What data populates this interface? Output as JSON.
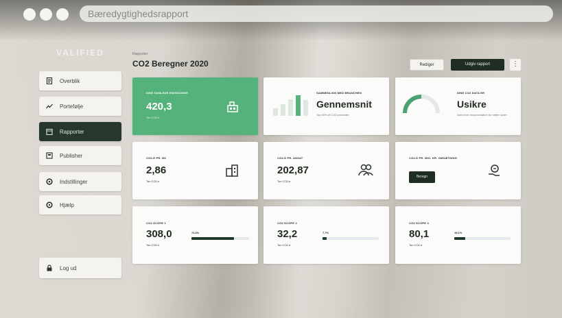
{
  "window": {
    "url_title": "Bæredygtighedsrapport"
  },
  "brand": {
    "logo_text": "VALIFIED"
  },
  "sidebar": {
    "items": [
      {
        "label": "Overblik",
        "icon": "document-icon"
      },
      {
        "label": "Portefølje",
        "icon": "trend-line-icon"
      },
      {
        "label": "Rapporter",
        "icon": "calendar-icon",
        "active": true
      },
      {
        "label": "Publisher",
        "icon": "publish-icon"
      },
      {
        "label": "Indstillinger",
        "icon": "gear-icon"
      },
      {
        "label": "Hjælp",
        "icon": "help-icon"
      }
    ],
    "logout_label": "Log ud"
  },
  "header": {
    "subtitle": "Rapporter",
    "title": "CO2 Beregner 2020",
    "edit_label": "Rediger",
    "export_label": "Udgiv rapport",
    "more_label": "⋮"
  },
  "cards": {
    "total": {
      "label": "DINE SAMLEDE EMISSIONER",
      "value": "420,3",
      "unit": "Ton CO2-e"
    },
    "compare": {
      "label": "SAMMENLIGN MED BRANCHEN",
      "value": "Gennemsnit",
      "note": "Top 40% af CO2 producter",
      "bars": [
        0.35,
        0.55,
        0.8,
        1.0,
        0.75
      ]
    },
    "data": {
      "label": "DINE CO2 DATA ER",
      "value": "Usikre",
      "note": "Add more documentation for better score"
    },
    "m2": {
      "label": "CO2-E PR. M2",
      "value": "2,86",
      "unit": "Ton CO2-e"
    },
    "employee": {
      "label": "CO2-E PR. ANSAT",
      "value": "202,87",
      "unit": "Ton CO2-e"
    },
    "revenue": {
      "label": "CO2-E PR. MIO. KR. OMSÆTNING",
      "button": "Beregn"
    },
    "scope1": {
      "label": "CO2 SCOPE 1",
      "value": "308,0",
      "unit": "Ton CO2-e",
      "pct_label": "73,3%",
      "pct": 0.733
    },
    "scope2": {
      "label": "CO2 SCOPE 2",
      "value": "32,2",
      "unit": "Ton CO2-e",
      "pct_label": "7,7%",
      "pct": 0.077
    },
    "scope3": {
      "label": "CO2 SCOPE 3",
      "value": "80,1",
      "unit": "Ton CO2-e",
      "pct_label": "19,1%",
      "pct": 0.191
    }
  },
  "colors": {
    "accent_green": "#54b27a",
    "dark_green": "#1f2d23",
    "gauge_green": "#4aa272"
  }
}
